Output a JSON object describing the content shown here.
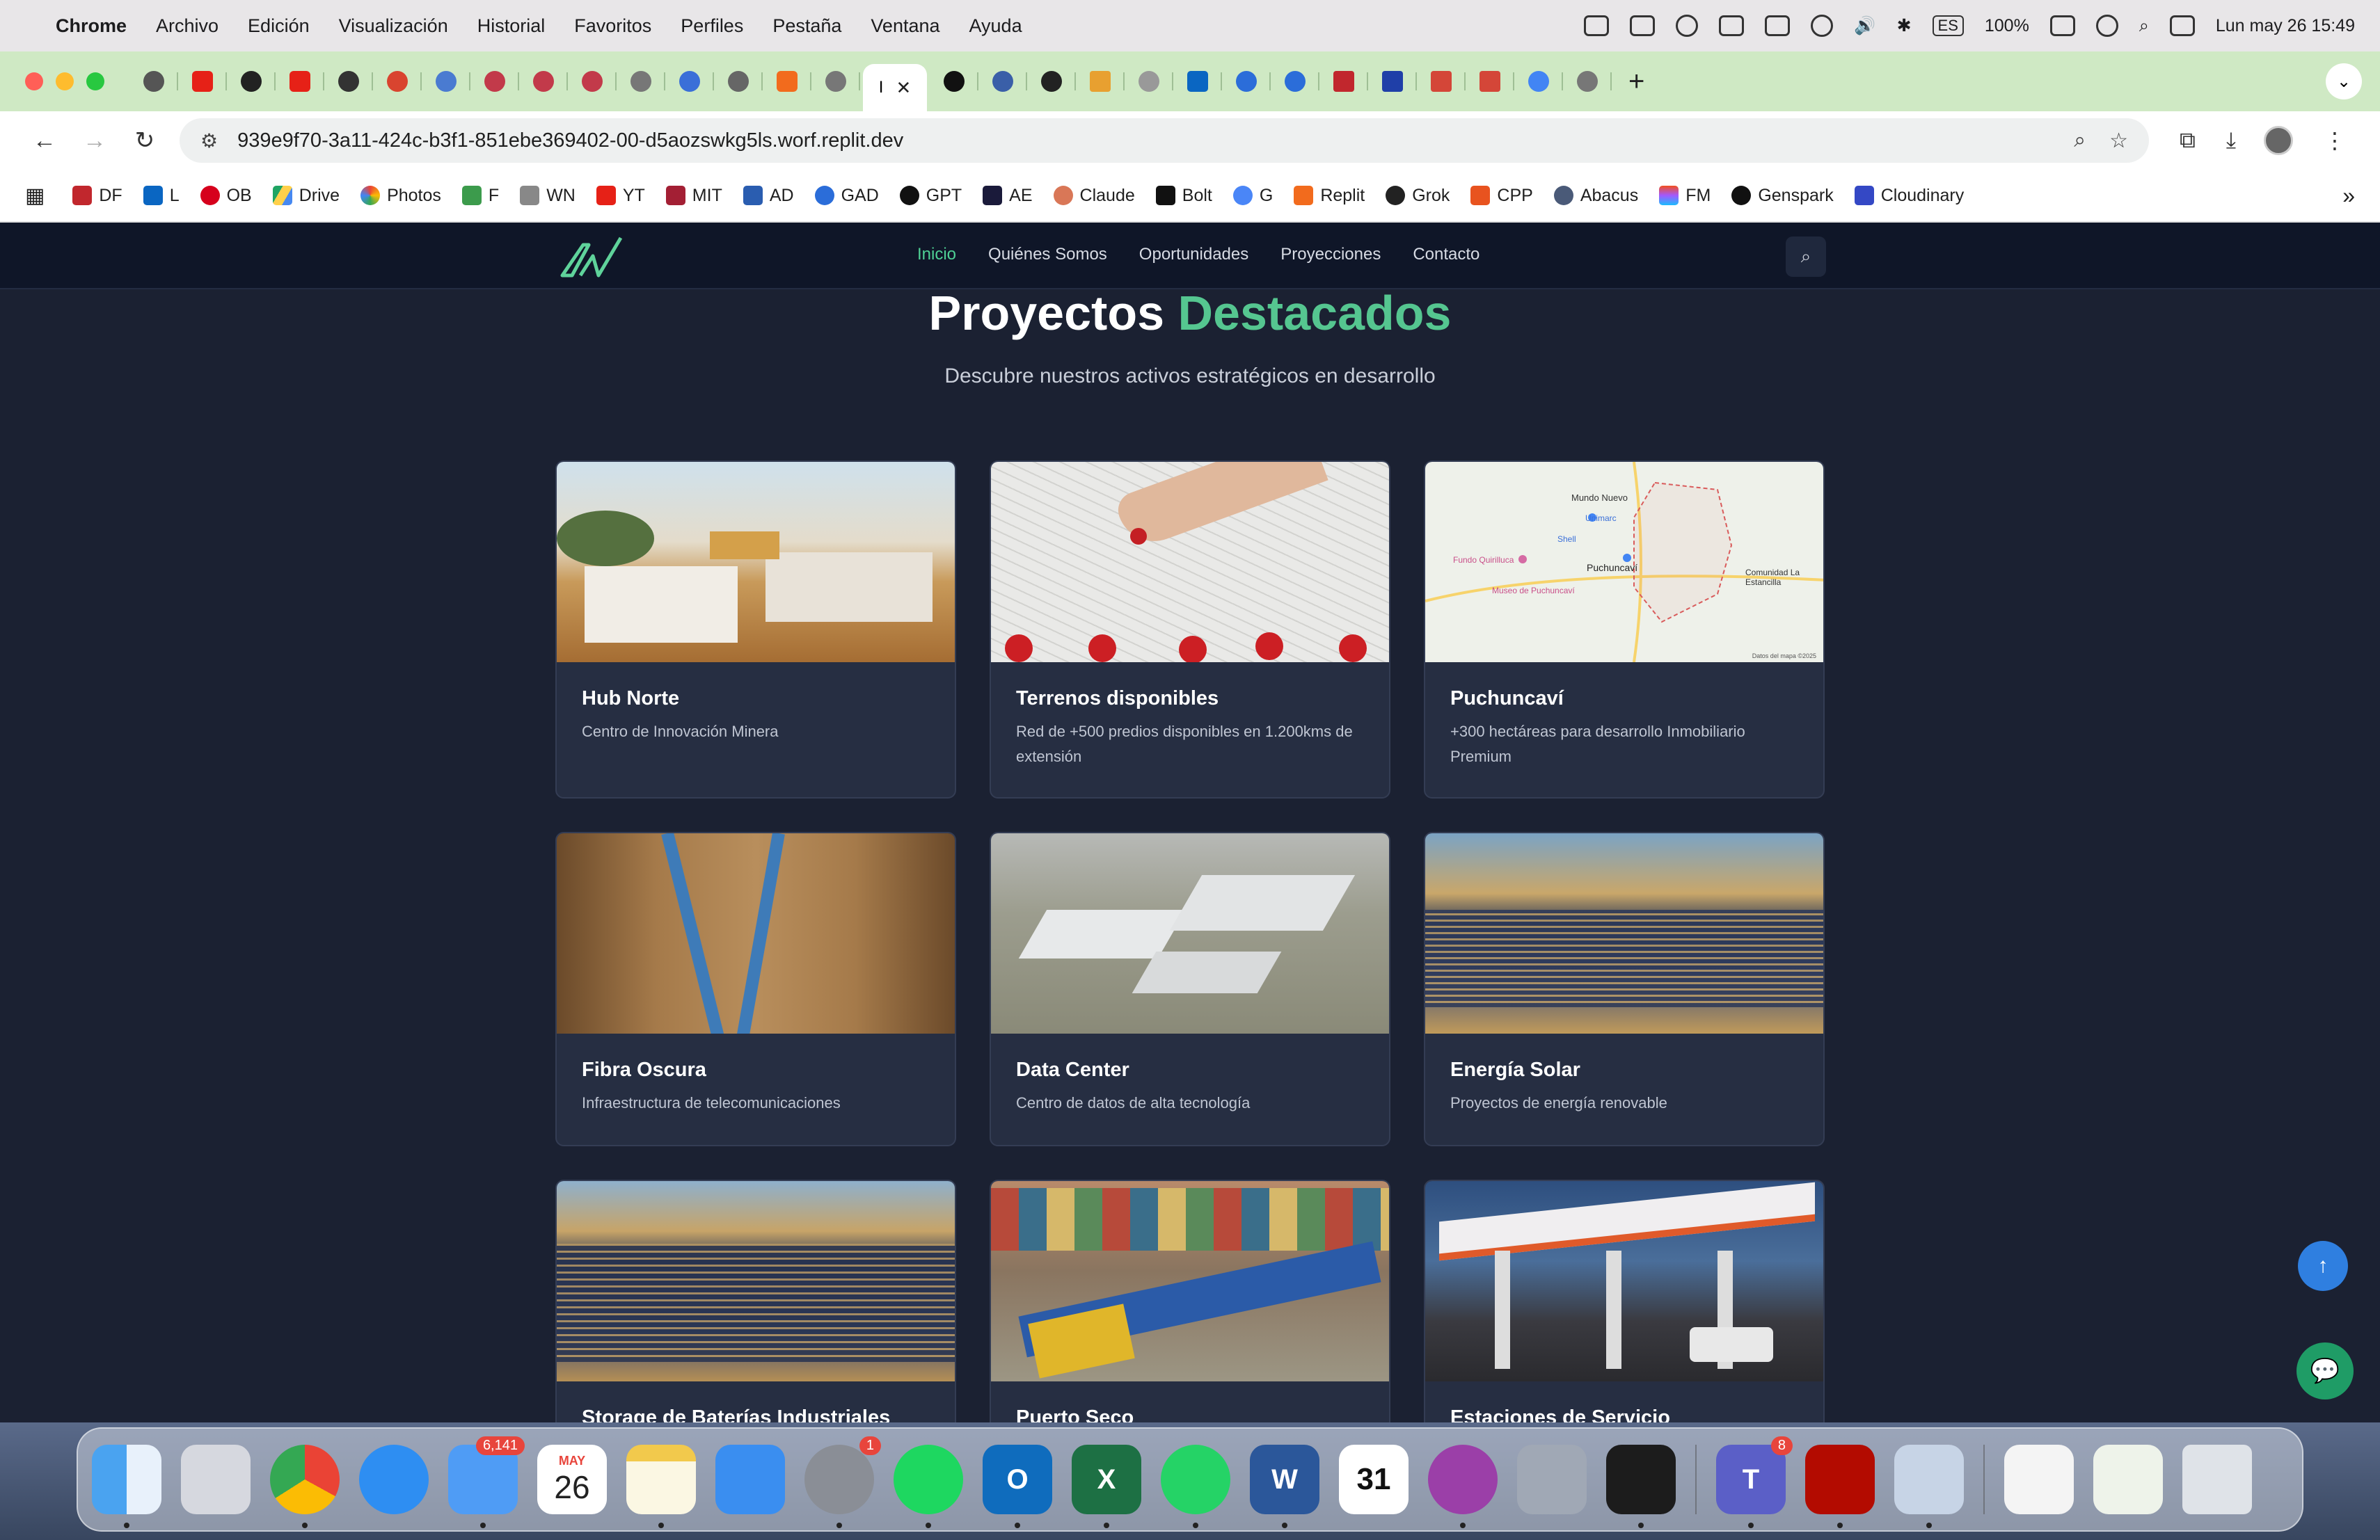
{
  "menubar": {
    "app_name": "Chrome",
    "items": [
      "Archivo",
      "Edición",
      "Visualización",
      "Historial",
      "Favoritos",
      "Perfiles",
      "Pestaña",
      "Ventana",
      "Ayuda"
    ],
    "keyboard": "ES",
    "battery": "100%",
    "datetime": "Lun may 26  15:49"
  },
  "tabs": {
    "active_label": "I",
    "close_glyph": "✕",
    "new_tab_glyph": "+"
  },
  "toolbar": {
    "url": "939e9f70-3a11-424c-b3f1-851ebe369402-00-d5aozswkg5ls.worf.replit.dev"
  },
  "bookmarks": [
    "DF",
    "L",
    "OB",
    "Drive",
    "Photos",
    "F",
    "WN",
    "YT",
    "MIT",
    "AD",
    "GAD",
    "GPT",
    "AE",
    "Claude",
    "Bolt",
    "G",
    "Replit",
    "Grok",
    "CPP",
    "Abacus",
    "FM",
    "Genspark",
    "Cloudinary"
  ],
  "site": {
    "nav": [
      "Inicio",
      "Quiénes Somos",
      "Oportunidades",
      "Proyecciones",
      "Contacto"
    ],
    "title_main": "Proyectos",
    "title_accent": "Destacados",
    "subtitle": "Descubre nuestros activos estratégicos en desarrollo",
    "cards": [
      {
        "title": "Hub Norte",
        "desc": "Centro de Innovación Minera"
      },
      {
        "title": "Terrenos disponibles",
        "desc": "Red de +500 predios disponibles en 1.200kms de extensión"
      },
      {
        "title": "Puchuncaví",
        "desc": "+300 hectáreas para desarrollo Inmobiliario Premium"
      },
      {
        "title": "Fibra Oscura",
        "desc": "Infraestructura de telecomunicaciones"
      },
      {
        "title": "Data Center",
        "desc": "Centro de datos de alta tecnología"
      },
      {
        "title": "Energía Solar",
        "desc": "Proyectos de energía renovable"
      },
      {
        "title": "Storage de Baterías Industriales",
        "desc": ""
      },
      {
        "title": "Puerto Seco",
        "desc": ""
      },
      {
        "title": "Estaciones de Servicio",
        "desc": ""
      }
    ],
    "map_labels": [
      "Mundo Nuevo",
      "Unimarc",
      "Shell",
      "Fundo Quirilluca",
      "Puchuncaví",
      "Comunidad La Estancilla",
      "Museo de Puchuncaví",
      "Datos del mapa ©2025"
    ]
  },
  "dock": {
    "mail_badge": "6,141",
    "calendar_month": "MAY",
    "calendar_day": "26",
    "settings_badge": "1",
    "teams_badge": "8",
    "fantastical_day": "31"
  },
  "colors": {
    "accent_green": "#55c690",
    "nav_active": "#4fd195",
    "background": "#1b2132",
    "card": "#262e42"
  }
}
